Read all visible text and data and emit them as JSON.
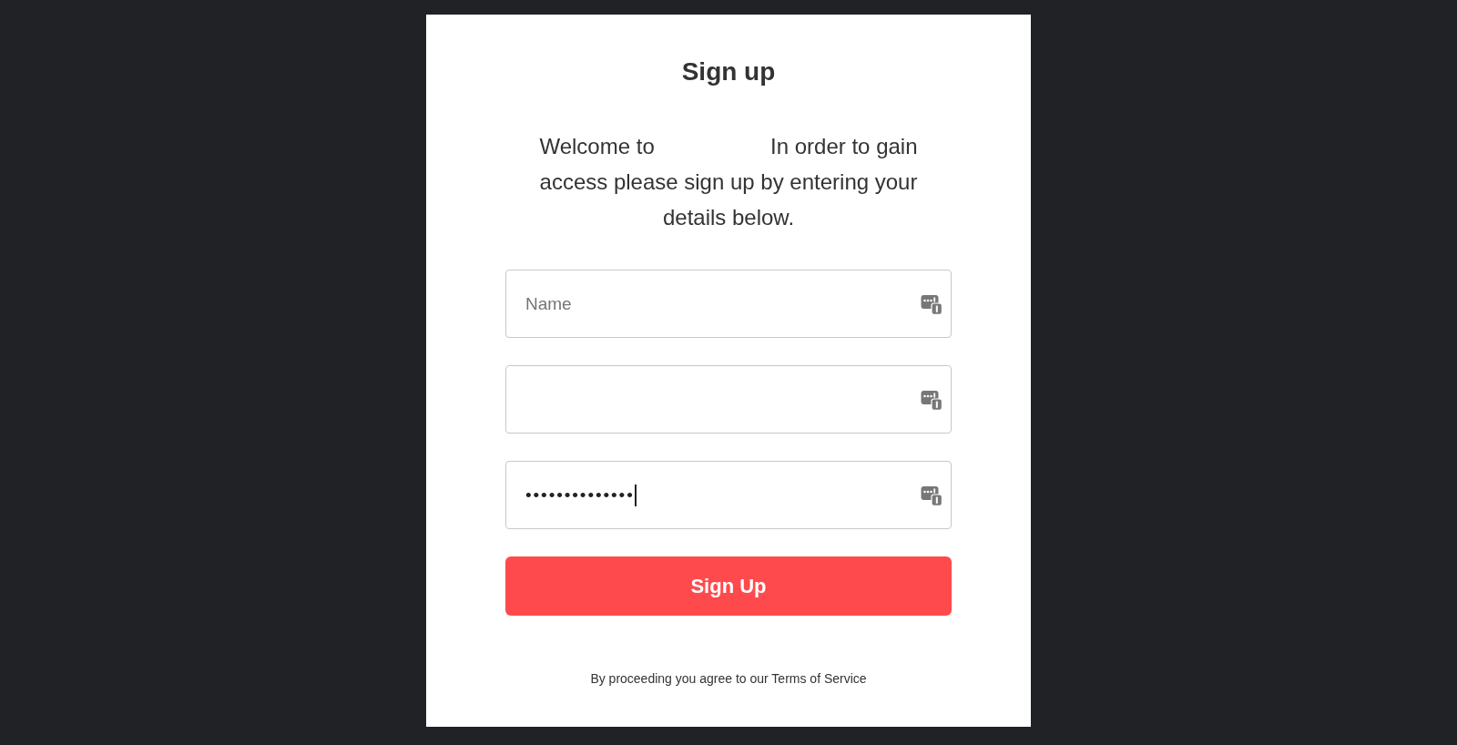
{
  "title": "Sign up",
  "intro": {
    "before_gap": "Welcome to",
    "after_gap": "In order to gain access please sign up by entering your details below."
  },
  "fields": [
    {
      "placeholder": "Name",
      "focused": false
    },
    {
      "focused": false
    },
    {
      "value": "••••••••••••••",
      "focused": true
    }
  ],
  "submit": {
    "label": "Sign Up"
  },
  "footer": "By proceeding you agree to our Terms of Service"
}
